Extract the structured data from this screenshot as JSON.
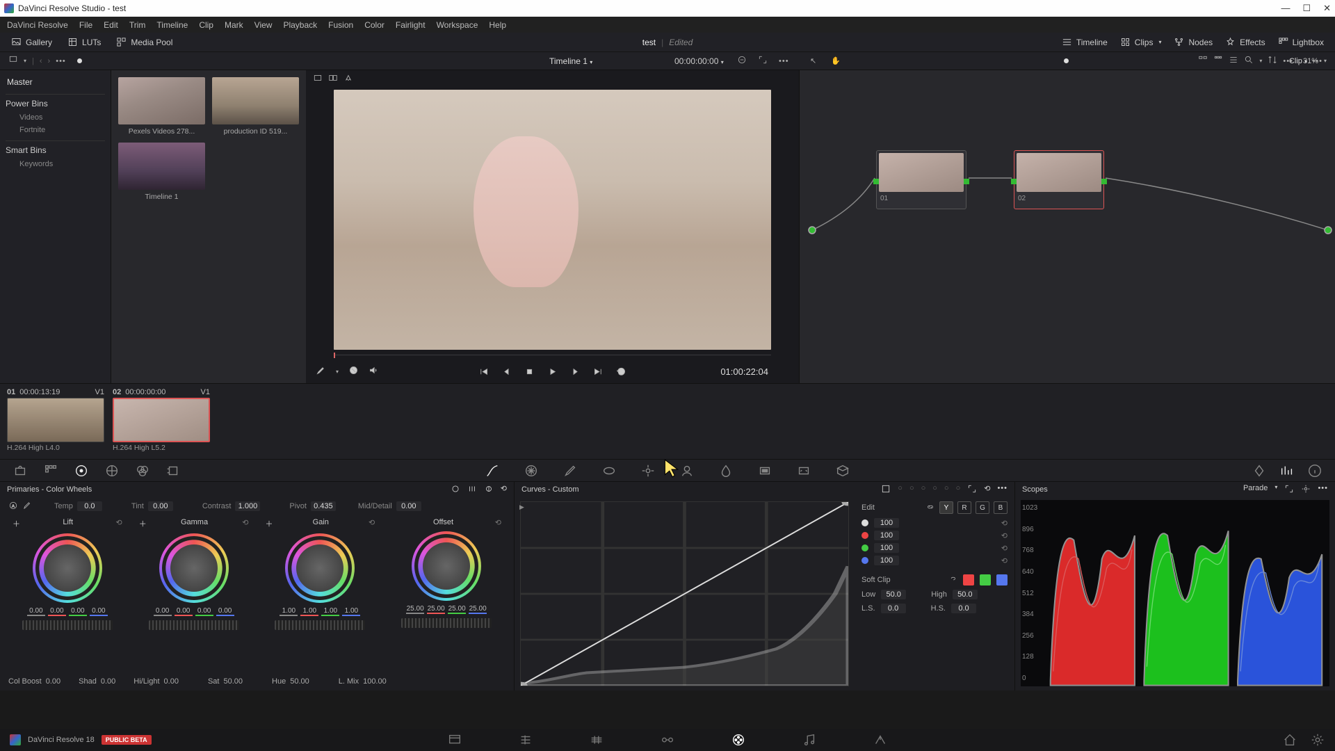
{
  "window": {
    "title": "DaVinci Resolve Studio - test"
  },
  "menubar": [
    "DaVinci Resolve",
    "File",
    "Edit",
    "Trim",
    "Timeline",
    "Clip",
    "Mark",
    "View",
    "Playback",
    "Fusion",
    "Color",
    "Fairlight",
    "Workspace",
    "Help"
  ],
  "toolbar": {
    "gallery": "Gallery",
    "luts": "LUTs",
    "mediapool": "Media Pool",
    "project": "test",
    "edited": "Edited",
    "timeline": "Timeline",
    "clips": "Clips",
    "nodes": "Nodes",
    "effects": "Effects",
    "lightbox": "Lightbox"
  },
  "secondbar": {
    "zoom": "31%",
    "timeline_name": "Timeline 1",
    "timecode": "00:00:00:00",
    "clip_dropdown": "Clip"
  },
  "sidebar": {
    "master": "Master",
    "powerbins": "Power Bins",
    "pb_items": [
      "Videos",
      "Fortnite"
    ],
    "smartbins": "Smart Bins",
    "sb_items": [
      "Keywords"
    ]
  },
  "media": [
    {
      "label": "Pexels Videos 278..."
    },
    {
      "label": "production ID 519..."
    },
    {
      "label": "Timeline 1"
    }
  ],
  "transport": {
    "tc": "01:00:22:04"
  },
  "nodes": {
    "n1": "01",
    "n2": "02"
  },
  "clipstrip": [
    {
      "num": "01",
      "tc": "00:00:13:19",
      "layer": "V1",
      "codec": "H.264 High L4.0"
    },
    {
      "num": "02",
      "tc": "00:00:00:00",
      "layer": "V1",
      "codec": "H.264 High L5.2"
    }
  ],
  "primaries": {
    "title": "Primaries - Color Wheels",
    "temp_l": "Temp",
    "temp": "0.0",
    "tint_l": "Tint",
    "tint": "0.00",
    "contrast_l": "Contrast",
    "contrast": "1.000",
    "pivot_l": "Pivot",
    "pivot": "0.435",
    "md_l": "Mid/Detail",
    "md": "0.00",
    "wheels": {
      "lift": {
        "t": "Lift",
        "v": [
          "0.00",
          "0.00",
          "0.00",
          "0.00"
        ]
      },
      "gamma": {
        "t": "Gamma",
        "v": [
          "0.00",
          "0.00",
          "0.00",
          "0.00"
        ]
      },
      "gain": {
        "t": "Gain",
        "v": [
          "1.00",
          "1.00",
          "1.00",
          "1.00"
        ]
      },
      "offset": {
        "t": "Offset",
        "v": [
          "25.00",
          "25.00",
          "25.00",
          "25.00"
        ]
      }
    },
    "bottom": {
      "colboost_l": "Col Boost",
      "colboost": "0.00",
      "shad_l": "Shad",
      "shad": "0.00",
      "hilight_l": "Hi/Light",
      "hilight": "0.00",
      "sat_l": "Sat",
      "sat": "50.00",
      "hue_l": "Hue",
      "hue": "50.00",
      "lmix_l": "L. Mix",
      "lmix": "100.00"
    }
  },
  "curves": {
    "title": "Curves - Custom",
    "edit": "Edit",
    "ch_y": "Y",
    "ch_r": "R",
    "ch_g": "G",
    "ch_b": "B",
    "intensity": {
      "y": "100",
      "r": "100",
      "g": "100",
      "b": "100"
    },
    "softclip": "Soft Clip",
    "low_l": "Low",
    "low": "50.0",
    "high_l": "High",
    "high": "50.0",
    "ls_l": "L.S.",
    "ls": "0.0",
    "hs_l": "H.S.",
    "hs": "0.0"
  },
  "scopes": {
    "title": "Scopes",
    "mode": "Parade",
    "ticks": [
      "1023",
      "896",
      "768",
      "640",
      "512",
      "384",
      "256",
      "128",
      "0"
    ]
  },
  "footer": {
    "app": "DaVinci Resolve 18",
    "beta": "PUBLIC BETA"
  }
}
